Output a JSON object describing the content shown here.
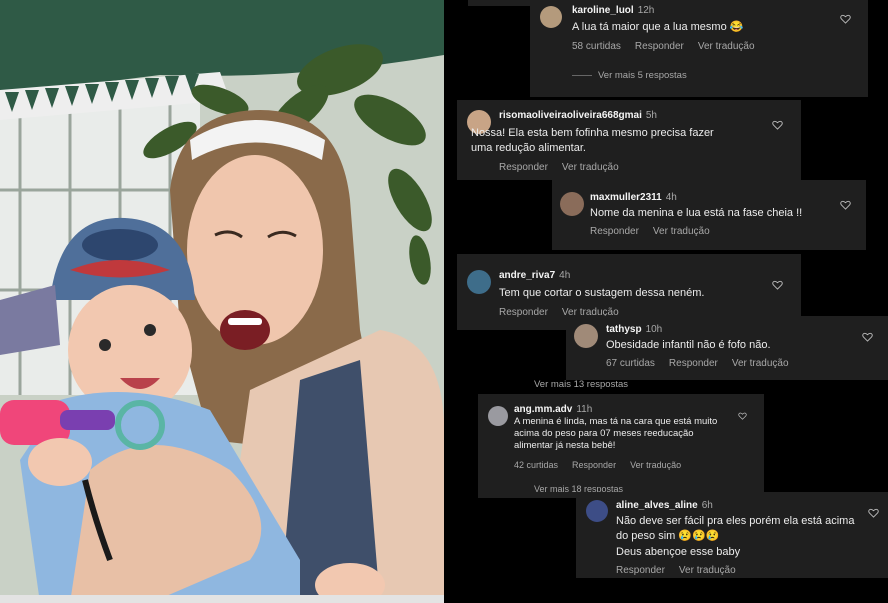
{
  "comments": [
    {
      "user": "karoline_luol",
      "time": "12h",
      "text": "A lua tá maior que a lua mesmo 😂",
      "likes": "58 curtidas",
      "reply": "Responder",
      "translate": "Ver tradução",
      "more": "Ver mais 5 respostas"
    },
    {
      "user": "risomaoliveiraoliveira668gmai",
      "time": "5h",
      "text": "Nossa! Ela esta bem fofinha mesmo precisa fazer  uma redução  alimentar.",
      "reply": "Responder",
      "translate": "Ver tradução"
    },
    {
      "user": "maxmuller2311",
      "time": "4h",
      "text": "Nome da menina e lua está na fase cheia !!",
      "reply": "Responder",
      "translate": "Ver tradução"
    },
    {
      "user": "andre_riva7",
      "time": "4h",
      "text": "Tem que cortar o sustagem dessa neném.",
      "reply": "Responder",
      "translate": "Ver tradução"
    },
    {
      "user": "tathysp",
      "time": "10h",
      "text": "Obesidade infantil não é fofo não.",
      "likes": "67 curtidas",
      "reply": "Responder",
      "translate": "Ver tradução",
      "more": "Ver mais 13 respostas"
    },
    {
      "user": "ang.mm.adv",
      "time": "11h",
      "text": "A menina é linda, mas tá na cara que está muito acima do peso para 07 meses reeducação alimentar já nesta bebê!",
      "likes": "42 curtidas",
      "reply": "Responder",
      "translate": "Ver tradução",
      "more": "Ver mais 18 respostas"
    },
    {
      "user": "aline_alves_aline",
      "time": "6h",
      "text": "Não deve ser fácil pra eles porém ela está acima do peso sim 😢😢😢",
      "text2": "Deus abençoe esse baby",
      "reply": "Responder",
      "translate": "Ver tradução"
    }
  ]
}
